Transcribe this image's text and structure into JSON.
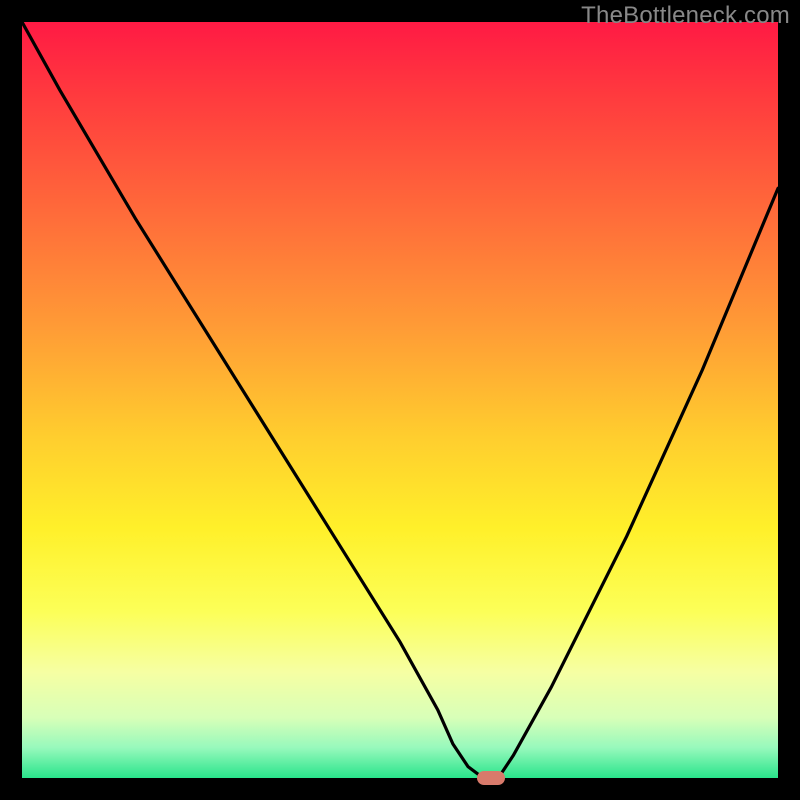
{
  "watermark": "TheBottleneck.com",
  "colors": {
    "frame": "#000000",
    "gradient_top": "#ff1a44",
    "gradient_bottom": "#29e48b",
    "curve": "#000000",
    "marker": "#d87a6b",
    "watermark_text": "#888888"
  },
  "chart_data": {
    "type": "line",
    "title": "",
    "xlabel": "",
    "ylabel": "",
    "xlim": [
      0,
      100
    ],
    "ylim": [
      0,
      100
    ],
    "grid": false,
    "series": [
      {
        "name": "bottleneck-curve",
        "x": [
          0,
          5,
          10,
          15,
          20,
          25,
          30,
          35,
          40,
          45,
          50,
          55,
          57,
          59,
          61,
          63,
          65,
          70,
          75,
          80,
          85,
          90,
          95,
          100
        ],
        "y": [
          100,
          91,
          82.5,
          74,
          66,
          58,
          50,
          42,
          34,
          26,
          18,
          9,
          4.5,
          1.5,
          0,
          0,
          3,
          12,
          22,
          32,
          43,
          54,
          66,
          78
        ]
      }
    ],
    "marker": {
      "x": 62,
      "y": 0,
      "width_pct": 3.7,
      "height_pct": 1.9
    },
    "legend": false
  }
}
